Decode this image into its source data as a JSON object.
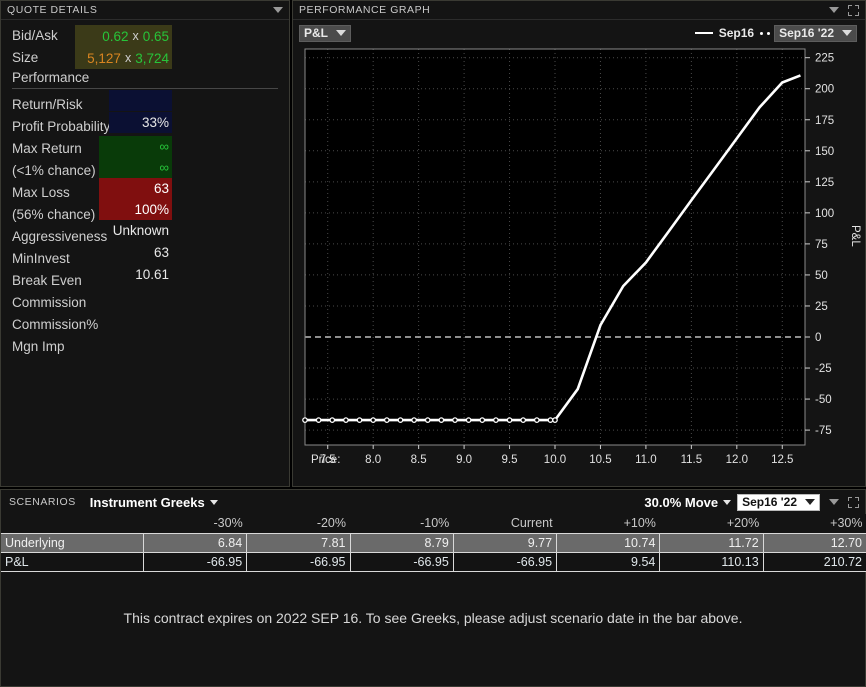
{
  "quote": {
    "title": "QUOTE DETAILS",
    "bidask_label": "Bid/Ask",
    "bid": "0.62",
    "ask": "0.65",
    "size_label": "Size",
    "size_bid": "5,127",
    "size_ask": "3,724",
    "multiply": "x",
    "performance_header": "Performance",
    "rows": [
      {
        "label": "Return/Risk",
        "value": ""
      },
      {
        "label": "Profit Probability",
        "value": "33%"
      },
      {
        "label": "Max Return",
        "value": "∞"
      },
      {
        "label": "(<1% chance)",
        "value": "∞"
      },
      {
        "label": "Max Loss",
        "value": "63"
      },
      {
        "label": "(56% chance)",
        "value": "100%"
      },
      {
        "label": "Aggressiveness",
        "value": "Unknown"
      },
      {
        "label": "MinInvest",
        "value": "63"
      },
      {
        "label": "Break Even",
        "value": "10.61"
      },
      {
        "label": "Commission",
        "value": ""
      },
      {
        "label": "Commission%",
        "value": ""
      },
      {
        "label": "Mgn Imp",
        "value": ""
      }
    ],
    "colors": {
      "bid_ask_bg": "#3b3a18",
      "green": "#27c43a",
      "orange": "#d98521",
      "navy": "#0b1033",
      "max_return_bg": "#093b09",
      "max_loss_bg": "#800f0f"
    }
  },
  "graph": {
    "title": "PERFORMANCE GRAPH",
    "metric_select": "P&L",
    "legend_line_label": "Sep16",
    "date_select": "Sep16 '22"
  },
  "chart_data": {
    "type": "line",
    "title": "Performance Graph",
    "xlabel": "Price:",
    "ylabel": "P&L",
    "xlim": [
      7.25,
      12.75
    ],
    "ylim": [
      -87,
      232
    ],
    "xticks": [
      "7.5",
      "8.0",
      "8.5",
      "9.0",
      "9.5",
      "10.0",
      "10.5",
      "11.0",
      "11.5",
      "12.0",
      "12.5"
    ],
    "xtick_values": [
      7.5,
      8.0,
      8.5,
      9.0,
      9.5,
      10.0,
      10.5,
      11.0,
      11.5,
      12.0,
      12.5
    ],
    "yticks": [
      "225",
      "200",
      "175",
      "150",
      "125",
      "100",
      "75",
      "50",
      "25",
      "0",
      "-25",
      "-50",
      "-75"
    ],
    "ytick_values": [
      225,
      200,
      175,
      150,
      125,
      100,
      75,
      50,
      25,
      0,
      -25,
      -50,
      -75
    ],
    "grid": true,
    "zero_line": 0,
    "legend_position": "top-right",
    "series": [
      {
        "name": "Sep16",
        "color": "#ffffff",
        "markers": true,
        "x": [
          7.25,
          7.4,
          7.55,
          7.7,
          7.85,
          8.0,
          8.15,
          8.3,
          8.45,
          8.6,
          8.75,
          8.9,
          9.05,
          9.2,
          9.35,
          9.5,
          9.65,
          9.8,
          9.95,
          10.0,
          10.25,
          10.5,
          10.75,
          11.0,
          11.25,
          11.5,
          11.75,
          12.0,
          12.25,
          12.5,
          12.7
        ],
        "y": [
          -66.95,
          -66.95,
          -66.95,
          -66.95,
          -66.95,
          -66.95,
          -66.95,
          -66.95,
          -66.95,
          -66.95,
          -66.95,
          -66.95,
          -66.95,
          -66.95,
          -66.95,
          -66.95,
          -66.95,
          -66.95,
          -66.95,
          -66.95,
          -41.95,
          9.54,
          41.0,
          60.0,
          85.0,
          110.13,
          135.0,
          160.0,
          185.0,
          205.0,
          210.72
        ]
      }
    ],
    "breakeven": 10.61
  },
  "scenarios": {
    "title": "SCENARIOS",
    "greeks_select": "Instrument Greeks",
    "move_select": "30.0% Move",
    "date_select": "Sep16 '22",
    "columns": [
      "",
      "-30%",
      "-20%",
      "-10%",
      "Current",
      "+10%",
      "+20%",
      "+30%"
    ],
    "rows": [
      {
        "label": "Underlying",
        "values": [
          "6.84",
          "7.81",
          "8.79",
          "9.77",
          "10.74",
          "11.72",
          "12.70"
        ]
      },
      {
        "label": "P&L",
        "values": [
          "-66.95",
          "-66.95",
          "-66.95",
          "-66.95",
          "9.54",
          "110.13",
          "210.72"
        ]
      }
    ],
    "note": "This contract expires on 2022 SEP 16. To see Greeks, please adjust scenario date in the bar above."
  }
}
